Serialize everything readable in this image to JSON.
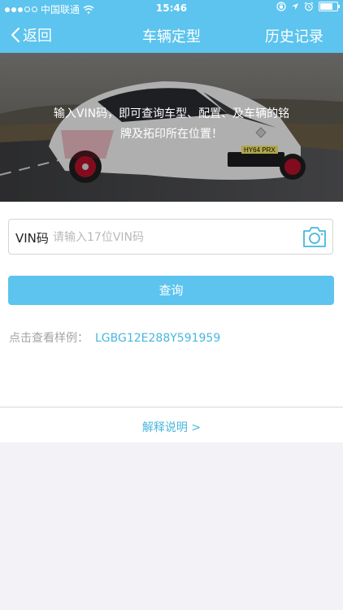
{
  "status_bar": {
    "carrier": "中国联通",
    "time": "15:46",
    "signal_bars": 3,
    "battery_level": 0.85
  },
  "nav": {
    "back_label": "返回",
    "title": "车辆定型",
    "history_label": "历史记录"
  },
  "banner": {
    "text": "输入VIN码，即可查询车型、配置、及车辆的铭牌及拓印所在位置！",
    "plate": "HY64 PRX"
  },
  "vin_field": {
    "label": "VIN码",
    "placeholder": "请输入17位VIN码",
    "value": ""
  },
  "query_button": {
    "label": "查询"
  },
  "sample": {
    "label": "点击查看样例：",
    "value": "LGBG12E288Y591959"
  },
  "explain_link": {
    "label": "解释说明 >"
  },
  "colors": {
    "accent": "#5cc4ee",
    "link": "#48b7de",
    "background": "#f3f3f7"
  },
  "icons": [
    "wifi-icon",
    "lock-icon",
    "location-arrow-icon",
    "alarm-icon",
    "battery-icon",
    "chevron-left-icon",
    "camera-icon"
  ]
}
